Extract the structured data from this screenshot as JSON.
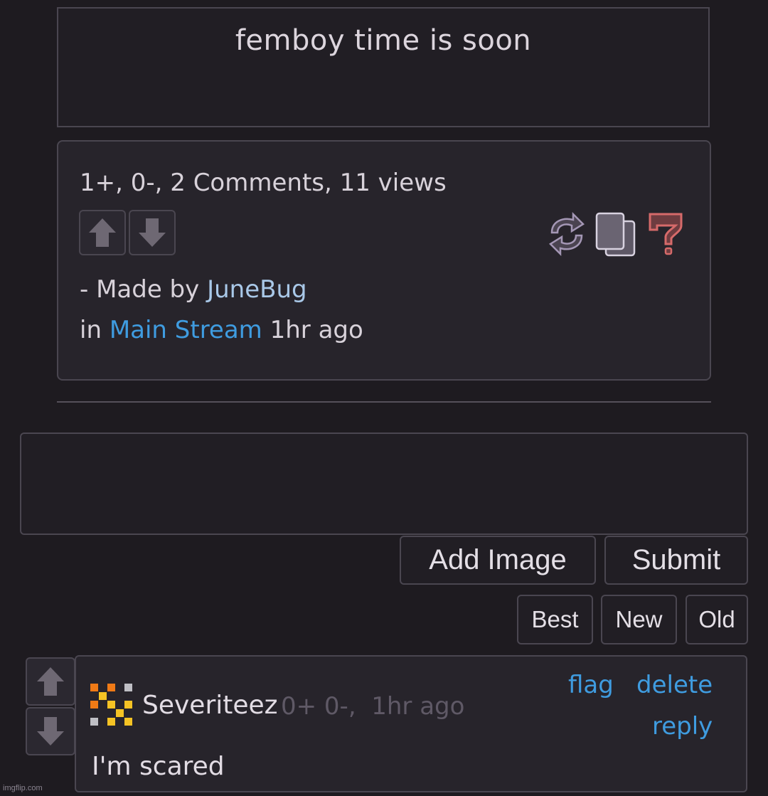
{
  "post": {
    "title": "femboy time is soon",
    "stats": "1+, 0-, 2 Comments, 11 views",
    "made_by_prefix": "- Made by",
    "author": "JuneBug",
    "in_prefix": "in",
    "stream": "Main Stream",
    "time": "1hr ago",
    "icons": [
      "upvote-icon",
      "downvote-icon",
      "repost-icon",
      "copy-icon",
      "report-icon"
    ]
  },
  "comment_form": {
    "add_image_label": "Add Image",
    "submit_label": "Submit"
  },
  "sort": {
    "best_label": "Best",
    "new_label": "New",
    "old_label": "Old"
  },
  "comment": {
    "author": "Severiteez",
    "meta": "0+ 0-,  1hr ago",
    "flag_label": "flag",
    "delete_label": "delete",
    "reply_label": "reply",
    "text": "I'm scared"
  },
  "watermark": "imgflip.com",
  "colors": {
    "background": "#1e1b20",
    "link": "#3f9ce0",
    "author_link": "#a9c8e8",
    "report": "#d66a6a"
  }
}
